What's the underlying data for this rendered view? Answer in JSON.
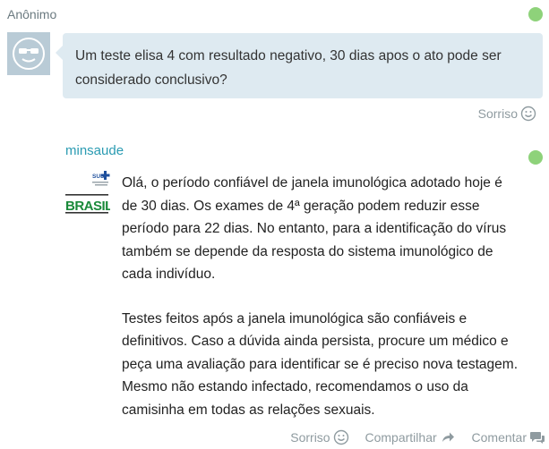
{
  "question": {
    "author": "Anônimo",
    "text": "Um teste elisa 4 com resultado negativo, 30 dias apos o ato pode ser considerado conclusivo?",
    "actions": {
      "smile_label": "Sorriso"
    }
  },
  "answer": {
    "author": "minsaude",
    "paragraphs": [
      "Olá, o período confiável de janela imunológica adotado hoje é de 30 dias. Os exames de 4ª geração podem reduzir esse período para 22 dias. No entanto, para a identificação do vírus também se depende da resposta do sistema imunológico de cada indivíduo.",
      "Testes feitos após a janela imunológica são confiáveis e definitivos. Caso a dúvida ainda persista, procure um médico e peça uma avaliação para identificar se é preciso nova testagem. Mesmo não estando infectado, recomendamos o uso da camisinha em todas as relações sexuais."
    ],
    "actions": {
      "smile_label": "Sorriso",
      "share_label": "Compartilhar",
      "comment_label": "Comentar"
    },
    "logo_text": {
      "sus": "SUS",
      "brasil": "BRASIL"
    }
  },
  "colors": {
    "online": "#8ed27a",
    "bubble": "#deeaf1",
    "author_link": "#2a9bb2"
  }
}
